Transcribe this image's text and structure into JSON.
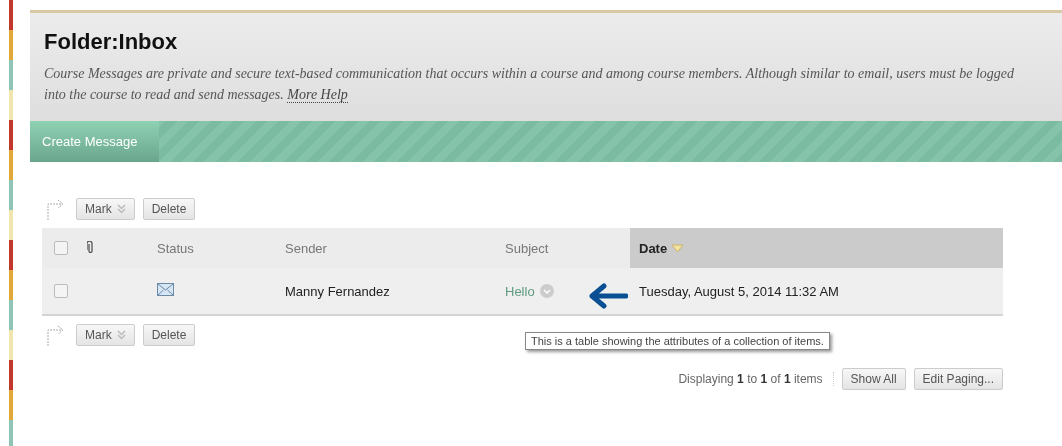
{
  "header": {
    "title": "Folder:Inbox",
    "description": "Course Messages are private and secure text-based communication that occurs within a course and among course members. Although similar to email, users must be logged into the course to read and send messages.",
    "help_link": "More Help"
  },
  "action_bar": {
    "buttons": [
      "Create Message"
    ]
  },
  "top_actions": [
    {
      "label": "Mark",
      "kind": "menu"
    },
    {
      "label": "Delete",
      "kind": "plain"
    }
  ],
  "table": {
    "columns": [
      {
        "kind": "checkbox",
        "checked": false
      },
      {
        "kind": "attachment"
      },
      {
        "kind": "text",
        "label": "Status",
        "sorted": false
      },
      {
        "kind": "text",
        "label": "Sender",
        "sorted": false
      },
      {
        "kind": "text",
        "label": "Subject",
        "sorted": false
      },
      {
        "kind": "text",
        "label": "Date",
        "sorted": true
      }
    ],
    "rows": [
      {
        "checked": false,
        "read": false,
        "sender": "Manny Fernandez",
        "subject": "Hello",
        "date": "Tuesday, August 5, 2014 11:32 AM"
      }
    ]
  },
  "bottom_actions": [
    {
      "label": "Mark",
      "kind": "menu"
    },
    {
      "label": "Delete",
      "kind": "plain"
    }
  ],
  "tooltip": "This is a table showing the attributes of a collection of items.",
  "paging": {
    "prefix": "Displaying",
    "from": "1",
    "to_word": "to",
    "to": "1",
    "of_word": "of",
    "total": "1",
    "suffix": "items",
    "buttons": [
      "Show All",
      "Edit Paging..."
    ]
  }
}
